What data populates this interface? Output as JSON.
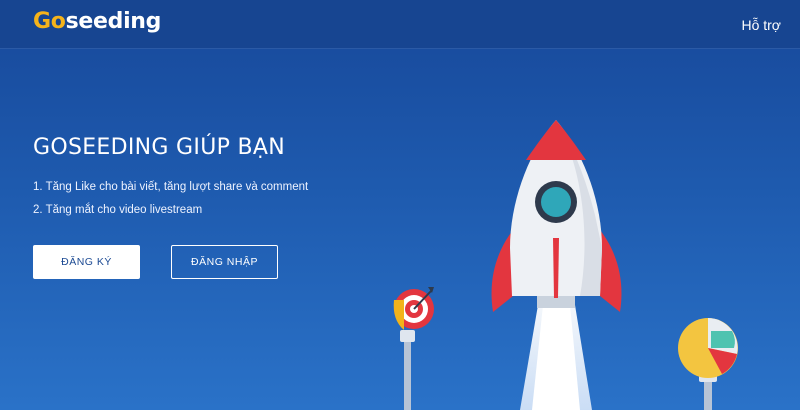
{
  "header": {
    "logo_part1": "Go",
    "logo_part2": "seeding",
    "support_link": "Hỗ trợ"
  },
  "hero": {
    "title": "GOSEEDING GIÚP BẠN",
    "features": [
      "1. Tăng Like cho bài viết, tăng lượt share và comment",
      "2. Tăng mắt cho video livestream"
    ],
    "register_button": "ĐĂNG KÝ",
    "login_button": "ĐĂNG NHẬP"
  },
  "colors": {
    "background": "#1e5aae",
    "logo_accent": "#f5b31b",
    "rocket_red": "#e3363f",
    "rocket_window": "#2fa7b9"
  },
  "illustrations": [
    "rocket",
    "target-lightbulb",
    "pie-chart-lightbulb"
  ]
}
